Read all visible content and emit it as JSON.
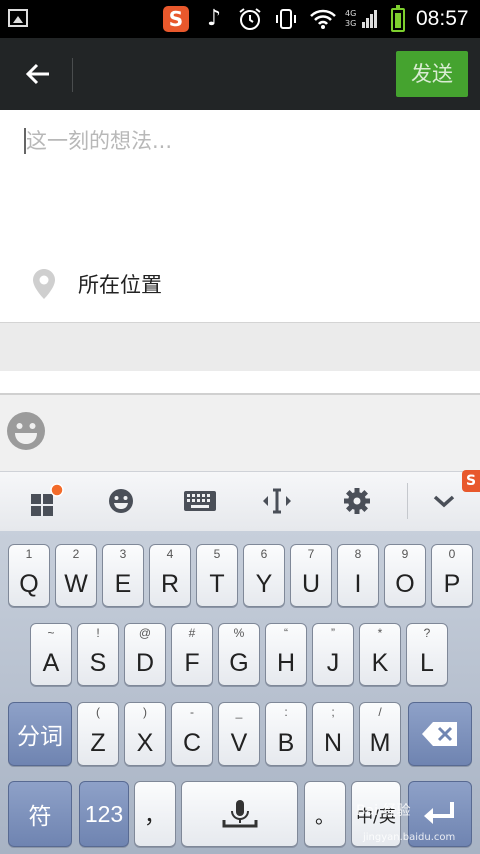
{
  "status_bar": {
    "clock": "08:57",
    "network_top": "4G",
    "network_bottom": "3G",
    "app_badge": "S",
    "icons": [
      "picture-icon",
      "sogou-icon",
      "music-muted-icon",
      "alarm-icon",
      "vibrate-icon",
      "wifi-icon",
      "signal-icon",
      "battery-icon"
    ]
  },
  "header": {
    "back_icon": "arrow-left-icon",
    "send_label": "发送",
    "accent_color": "#45a32f"
  },
  "compose": {
    "placeholder": "这一刻的想法...",
    "location_label": "所在位置",
    "location_icon": "map-pin-icon"
  },
  "emoji_bar": {
    "icon": "smiley-icon"
  },
  "keyboard_toolbar": {
    "items": [
      "apps-grid-icon",
      "emoji-icon",
      "keyboard-icon",
      "cursor-move-icon",
      "settings-icon",
      "collapse-chevron-icon"
    ]
  },
  "keyboard": {
    "row1": [
      {
        "main": "Q",
        "sub": "1"
      },
      {
        "main": "W",
        "sub": "2"
      },
      {
        "main": "E",
        "sub": "3"
      },
      {
        "main": "R",
        "sub": "4"
      },
      {
        "main": "T",
        "sub": "5"
      },
      {
        "main": "Y",
        "sub": "6"
      },
      {
        "main": "U",
        "sub": "7"
      },
      {
        "main": "I",
        "sub": "8"
      },
      {
        "main": "O",
        "sub": "9"
      },
      {
        "main": "P",
        "sub": "0"
      }
    ],
    "row2": [
      {
        "main": "A",
        "sub": "~"
      },
      {
        "main": "S",
        "sub": "!"
      },
      {
        "main": "D",
        "sub": "@"
      },
      {
        "main": "F",
        "sub": "#"
      },
      {
        "main": "G",
        "sub": "%"
      },
      {
        "main": "H",
        "sub": "“"
      },
      {
        "main": "J",
        "sub": "”"
      },
      {
        "main": "K",
        "sub": "*"
      },
      {
        "main": "L",
        "sub": "?"
      }
    ],
    "row3": [
      {
        "main": "Z",
        "sub": "("
      },
      {
        "main": "X",
        "sub": ")"
      },
      {
        "main": "C",
        "sub": "-"
      },
      {
        "main": "V",
        "sub": "_"
      },
      {
        "main": "B",
        "sub": ":"
      },
      {
        "main": "N",
        "sub": ";"
      },
      {
        "main": "M",
        "sub": "/"
      }
    ],
    "segment_key": "分词",
    "symbol_key": "符",
    "numbers_key": "123",
    "comma_key": "，",
    "period_key": "。",
    "lang_key": "中/英",
    "enter_icon": "enter-icon",
    "backspace_icon": "backspace-icon",
    "mic_icon": "microphone-icon"
  },
  "watermark": {
    "brand": "Bai 经验",
    "url": "jingyan.baidu.com"
  }
}
